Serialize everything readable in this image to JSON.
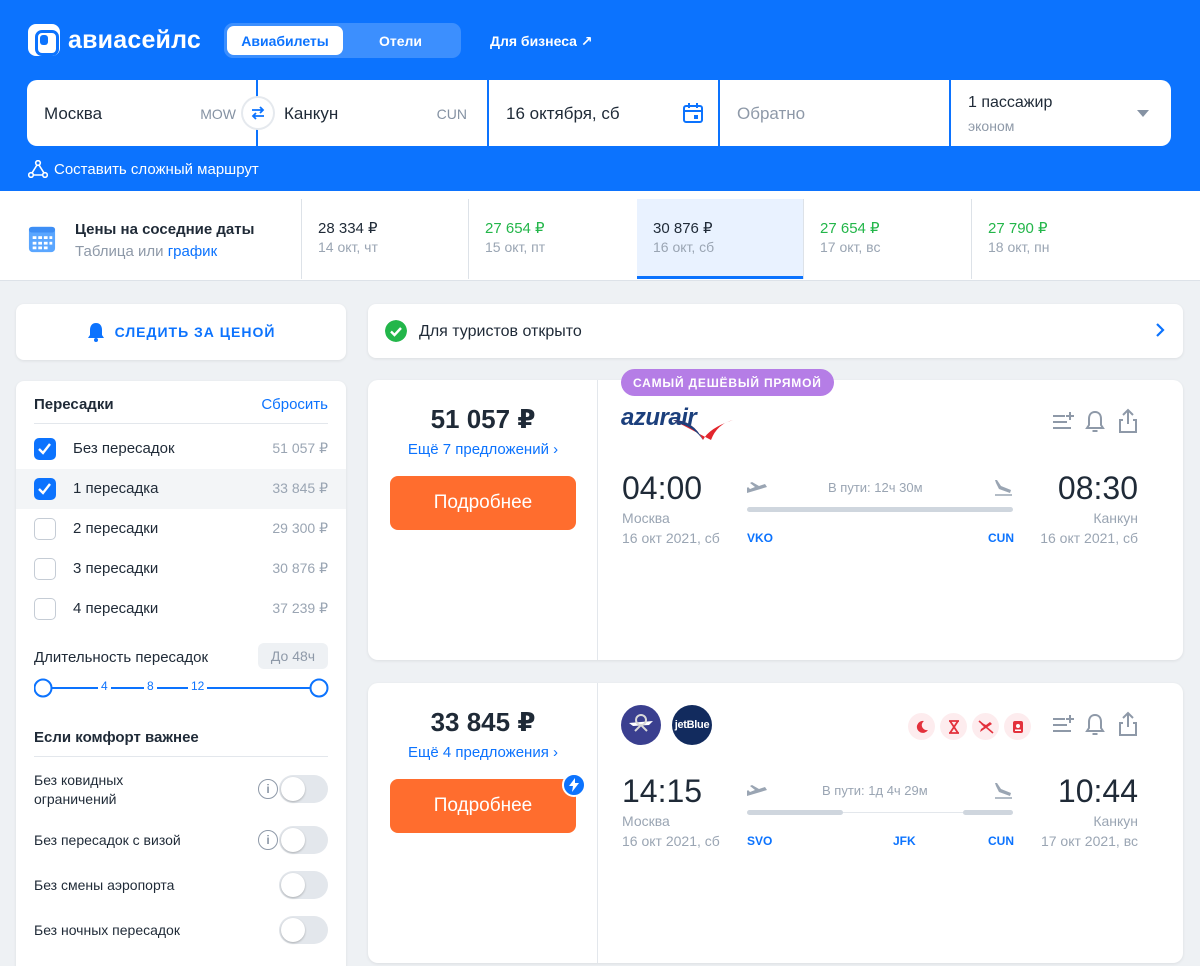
{
  "header": {
    "logo": "авиасейлс",
    "tabs": [
      "Авиабилеты",
      "Отели"
    ],
    "business_link": "Для бизнеса ↗"
  },
  "search": {
    "from": {
      "city": "Москва",
      "code": "MOW"
    },
    "to": {
      "city": "Канкун",
      "code": "CUN"
    },
    "date": "16 октября, сб",
    "return_placeholder": "Обратно",
    "passengers": "1 пассажир",
    "class": "эконом",
    "complex_route": "Составить сложный маршрут"
  },
  "near_dates": {
    "title": "Цены на соседние даты",
    "sub_table": "Таблица",
    "sub_or": " или ",
    "sub_chart": "график",
    "cells": [
      {
        "price": "28 334 ₽",
        "date": "14 окт, чт",
        "cheap": false
      },
      {
        "price": "27 654 ₽",
        "date": "15 окт, пт",
        "cheap": true
      },
      {
        "price": "30 876 ₽",
        "date": "16 окт, сб",
        "cheap": false
      },
      {
        "price": "27 654 ₽",
        "date": "17 окт, вс",
        "cheap": true
      },
      {
        "price": "27 790 ₽",
        "date": "18 окт, пн",
        "cheap": true
      }
    ]
  },
  "watch_price": "СЛЕДИТЬ ЗА ЦЕНОЙ",
  "filters": {
    "stops_title": "Пересадки",
    "reset": "Сбросить",
    "stops": [
      {
        "label": "Без пересадок",
        "price": "51 057 ₽",
        "checked": true
      },
      {
        "label": "1 пересадка",
        "price": "33 845 ₽",
        "checked": true
      },
      {
        "label": "2 пересадки",
        "price": "29 300 ₽",
        "checked": false
      },
      {
        "label": "3 пересадки",
        "price": "30 876 ₽",
        "checked": false
      },
      {
        "label": "4 пересадки",
        "price": "37 239 ₽",
        "checked": false
      }
    ],
    "duration_label": "Длительность пересадок",
    "duration_badge": "До 48ч",
    "slider_ticks": [
      "4",
      "8",
      "12"
    ],
    "comfort_title": "Если комфорт важнее",
    "toggles": [
      {
        "label": "Без ковидных\nограничений",
        "info": true
      },
      {
        "label": "Без пересадок с визой",
        "info": true
      },
      {
        "label": "Без смены аэропорта",
        "info": false
      },
      {
        "label": "Без ночных пересадок",
        "info": false
      }
    ]
  },
  "notice": "Для туристов открыто",
  "tickets": [
    {
      "badge": "САМЫЙ ДЕШЁВЫЙ ПРЯМОЙ",
      "price": "51 057 ₽",
      "offers": "Ещё 7 предложений ›",
      "more": "Подробнее",
      "airline": "azurair",
      "dep_time": "04:00",
      "dep_city": "Москва",
      "dep_date": "16 окт 2021, сб",
      "arr_time": "08:30",
      "arr_city": "Канкун",
      "arr_date": "16 окт 2021, сб",
      "duration": "В пути: 12ч 30м",
      "codes": [
        "VKO",
        "CUN"
      ]
    },
    {
      "price": "33 845 ₽",
      "offers": "Ещё 4 предложения ›",
      "more": "Подробнее",
      "airline2": "jetBlue",
      "dep_time": "14:15",
      "dep_city": "Москва",
      "dep_date": "16 окт 2021, сб",
      "arr_time": "10:44",
      "arr_city": "Канкун",
      "arr_date": "17 окт 2021, вс",
      "duration": "В пути: 1д 4ч 29м",
      "codes": [
        "SVO",
        "JFK",
        "CUN"
      ]
    }
  ],
  "colors": {
    "brand": "#0c73fe",
    "cta": "#ff6d2e",
    "cheap": "#23b64a",
    "badge": "#b57de6"
  }
}
